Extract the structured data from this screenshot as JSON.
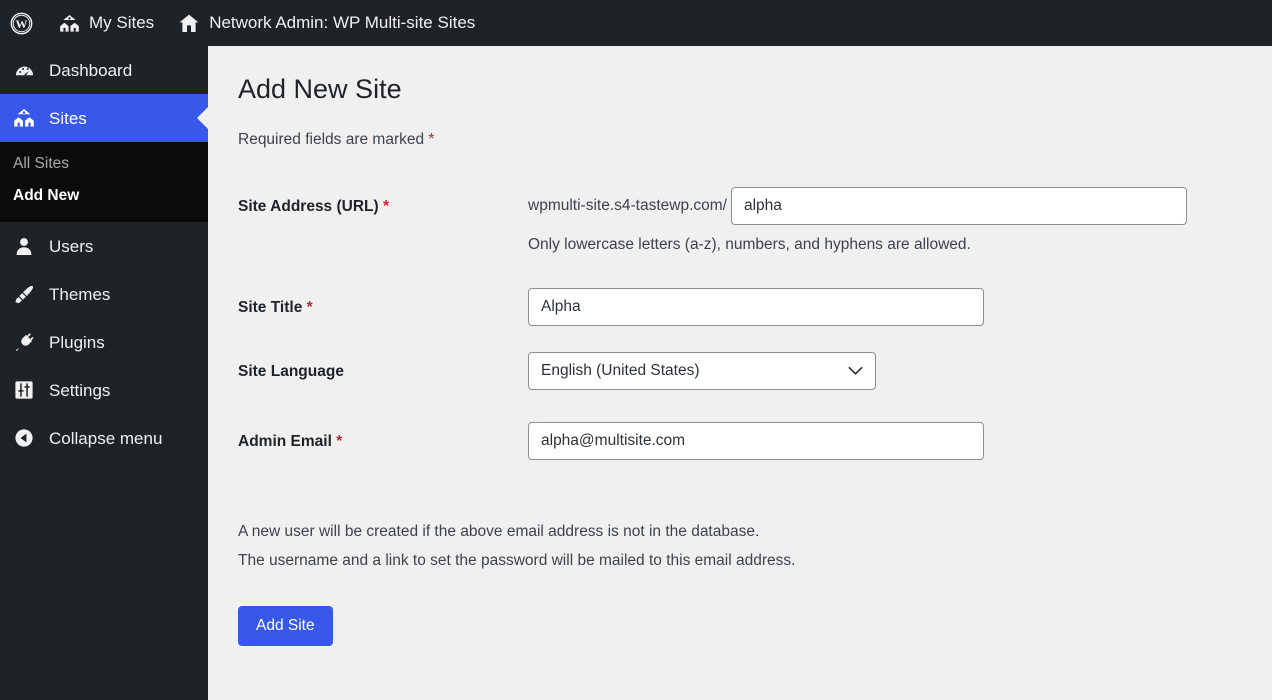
{
  "adminbar": {
    "logo_icon": "wordpress-logo-icon",
    "items": [
      {
        "label": "My Sites",
        "icon": "multisite-icon"
      },
      {
        "label": "Network Admin: WP Multi-site Sites",
        "icon": "home-icon"
      }
    ]
  },
  "sidebar": {
    "items": [
      {
        "label": "Dashboard",
        "icon": "dashboard-gauge-icon",
        "current": false
      },
      {
        "label": "Sites",
        "icon": "multisite-icon",
        "current": true
      },
      {
        "label": "Users",
        "icon": "user-icon",
        "current": false
      },
      {
        "label": "Themes",
        "icon": "paintbrush-icon",
        "current": false
      },
      {
        "label": "Plugins",
        "icon": "plug-icon",
        "current": false
      },
      {
        "label": "Settings",
        "icon": "sliders-icon",
        "current": false
      },
      {
        "label": "Collapse menu",
        "icon": "collapse-arrow-icon",
        "current": false
      }
    ],
    "submenu": [
      {
        "label": "All Sites",
        "current": false
      },
      {
        "label": "Add New",
        "current": true
      }
    ]
  },
  "main": {
    "title": "Add New Site",
    "required_note": "Required fields are marked",
    "required_marker": "*",
    "fields": {
      "site_address": {
        "label": "Site Address (URL)",
        "required": true,
        "prefix": "wpmulti-site.s4-tastewp.com/",
        "value": "alpha",
        "placeholder": "",
        "help": "Only lowercase letters (a-z), numbers, and hyphens are allowed."
      },
      "site_title": {
        "label": "Site Title",
        "required": true,
        "value": "Alpha",
        "placeholder": ""
      },
      "site_language": {
        "label": "Site Language",
        "required": false,
        "value": "English (United States)",
        "icon": "chevron-down-icon"
      },
      "admin_email": {
        "label": "Admin Email",
        "required": true,
        "value": "alpha@multisite.com",
        "placeholder": ""
      }
    },
    "note_line_1": "A new user will be created if the above email address is not in the database.",
    "note_line_2": "The username and a link to set the password will be mailed to this email address.",
    "submit_label": "Add Site"
  },
  "colors": {
    "accent": "#3858e9",
    "sidebar_bg": "#1d2327",
    "submenu_bg": "#0b0b0b",
    "page_bg": "#f0f0f1",
    "required_star": "#b32d2e"
  }
}
